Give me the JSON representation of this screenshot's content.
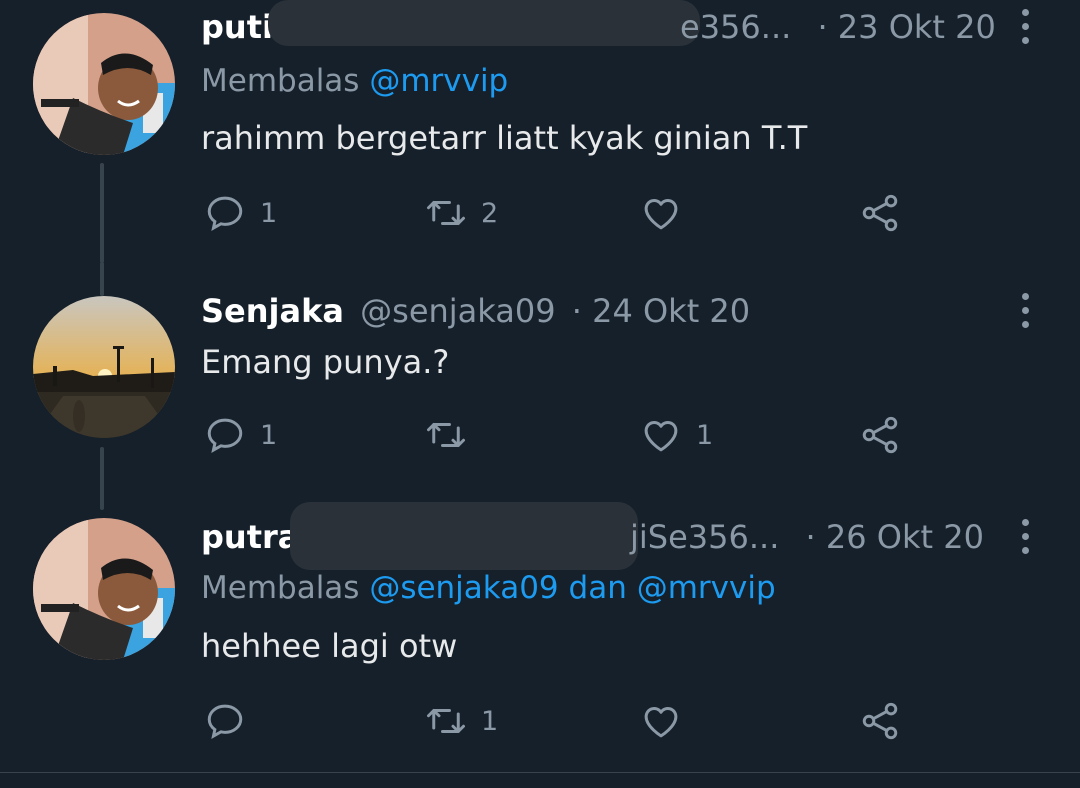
{
  "tweets": [
    {
      "name": "puti",
      "handle_tail": "e356...",
      "dot": "·",
      "time": "23 Okt 20",
      "reply_prefix": "Membalas",
      "reply_mentions": "@mrvvip",
      "reply_joiner": "",
      "reply_mention2": "",
      "text": "rahimm bergetarr liatt kyak ginian  T.T",
      "replies": "1",
      "retweets": "2",
      "likes": ""
    },
    {
      "name": "Senjaka",
      "handle": "@senjaka09",
      "dot": "·",
      "time": "24 Okt 20",
      "text": "Emang punya.?",
      "replies": "1",
      "retweets": "",
      "likes": "1"
    },
    {
      "name": "putra",
      "handle_tail": "jiSe356...",
      "dot": "·",
      "time": "26 Okt 20",
      "reply_prefix": "Membalas",
      "reply_mentions": "@senjaka09",
      "reply_joiner": "dan",
      "reply_mention2": "@mrvvip",
      "text": "hehhee lagi otw",
      "replies": "",
      "retweets": "1",
      "likes": ""
    }
  ],
  "icons": {
    "reply": "reply-icon",
    "retweet": "retweet-icon",
    "like": "heart-icon",
    "share": "share-icon",
    "more": "more-options-icon"
  },
  "colors": {
    "background": "#15202b",
    "mention": "#1d9bf0",
    "muted": "#8b98a5",
    "text": "#e7e9ea"
  }
}
